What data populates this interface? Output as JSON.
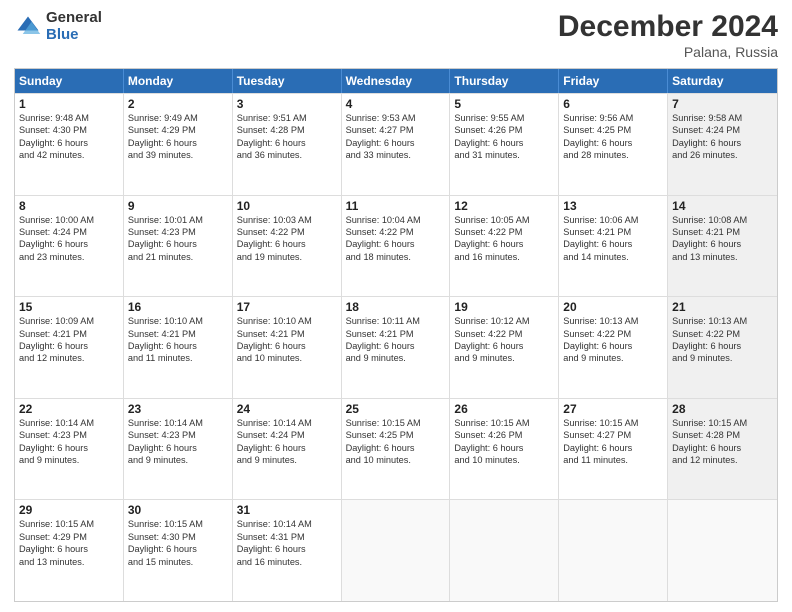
{
  "logo": {
    "general": "General",
    "blue": "Blue"
  },
  "title": {
    "month": "December 2024",
    "location": "Palana, Russia"
  },
  "header_days": [
    "Sunday",
    "Monday",
    "Tuesday",
    "Wednesday",
    "Thursday",
    "Friday",
    "Saturday"
  ],
  "weeks": [
    [
      {
        "day": "1",
        "info": "Sunrise: 9:48 AM\nSunset: 4:30 PM\nDaylight: 6 hours\nand 42 minutes.",
        "empty": false,
        "shaded": false
      },
      {
        "day": "2",
        "info": "Sunrise: 9:49 AM\nSunset: 4:29 PM\nDaylight: 6 hours\nand 39 minutes.",
        "empty": false,
        "shaded": false
      },
      {
        "day": "3",
        "info": "Sunrise: 9:51 AM\nSunset: 4:28 PM\nDaylight: 6 hours\nand 36 minutes.",
        "empty": false,
        "shaded": false
      },
      {
        "day": "4",
        "info": "Sunrise: 9:53 AM\nSunset: 4:27 PM\nDaylight: 6 hours\nand 33 minutes.",
        "empty": false,
        "shaded": false
      },
      {
        "day": "5",
        "info": "Sunrise: 9:55 AM\nSunset: 4:26 PM\nDaylight: 6 hours\nand 31 minutes.",
        "empty": false,
        "shaded": false
      },
      {
        "day": "6",
        "info": "Sunrise: 9:56 AM\nSunset: 4:25 PM\nDaylight: 6 hours\nand 28 minutes.",
        "empty": false,
        "shaded": false
      },
      {
        "day": "7",
        "info": "Sunrise: 9:58 AM\nSunset: 4:24 PM\nDaylight: 6 hours\nand 26 minutes.",
        "empty": false,
        "shaded": true
      }
    ],
    [
      {
        "day": "8",
        "info": "Sunrise: 10:00 AM\nSunset: 4:24 PM\nDaylight: 6 hours\nand 23 minutes.",
        "empty": false,
        "shaded": false
      },
      {
        "day": "9",
        "info": "Sunrise: 10:01 AM\nSunset: 4:23 PM\nDaylight: 6 hours\nand 21 minutes.",
        "empty": false,
        "shaded": false
      },
      {
        "day": "10",
        "info": "Sunrise: 10:03 AM\nSunset: 4:22 PM\nDaylight: 6 hours\nand 19 minutes.",
        "empty": false,
        "shaded": false
      },
      {
        "day": "11",
        "info": "Sunrise: 10:04 AM\nSunset: 4:22 PM\nDaylight: 6 hours\nand 18 minutes.",
        "empty": false,
        "shaded": false
      },
      {
        "day": "12",
        "info": "Sunrise: 10:05 AM\nSunset: 4:22 PM\nDaylight: 6 hours\nand 16 minutes.",
        "empty": false,
        "shaded": false
      },
      {
        "day": "13",
        "info": "Sunrise: 10:06 AM\nSunset: 4:21 PM\nDaylight: 6 hours\nand 14 minutes.",
        "empty": false,
        "shaded": false
      },
      {
        "day": "14",
        "info": "Sunrise: 10:08 AM\nSunset: 4:21 PM\nDaylight: 6 hours\nand 13 minutes.",
        "empty": false,
        "shaded": true
      }
    ],
    [
      {
        "day": "15",
        "info": "Sunrise: 10:09 AM\nSunset: 4:21 PM\nDaylight: 6 hours\nand 12 minutes.",
        "empty": false,
        "shaded": false
      },
      {
        "day": "16",
        "info": "Sunrise: 10:10 AM\nSunset: 4:21 PM\nDaylight: 6 hours\nand 11 minutes.",
        "empty": false,
        "shaded": false
      },
      {
        "day": "17",
        "info": "Sunrise: 10:10 AM\nSunset: 4:21 PM\nDaylight: 6 hours\nand 10 minutes.",
        "empty": false,
        "shaded": false
      },
      {
        "day": "18",
        "info": "Sunrise: 10:11 AM\nSunset: 4:21 PM\nDaylight: 6 hours\nand 9 minutes.",
        "empty": false,
        "shaded": false
      },
      {
        "day": "19",
        "info": "Sunrise: 10:12 AM\nSunset: 4:22 PM\nDaylight: 6 hours\nand 9 minutes.",
        "empty": false,
        "shaded": false
      },
      {
        "day": "20",
        "info": "Sunrise: 10:13 AM\nSunset: 4:22 PM\nDaylight: 6 hours\nand 9 minutes.",
        "empty": false,
        "shaded": false
      },
      {
        "day": "21",
        "info": "Sunrise: 10:13 AM\nSunset: 4:22 PM\nDaylight: 6 hours\nand 9 minutes.",
        "empty": false,
        "shaded": true
      }
    ],
    [
      {
        "day": "22",
        "info": "Sunrise: 10:14 AM\nSunset: 4:23 PM\nDaylight: 6 hours\nand 9 minutes.",
        "empty": false,
        "shaded": false
      },
      {
        "day": "23",
        "info": "Sunrise: 10:14 AM\nSunset: 4:23 PM\nDaylight: 6 hours\nand 9 minutes.",
        "empty": false,
        "shaded": false
      },
      {
        "day": "24",
        "info": "Sunrise: 10:14 AM\nSunset: 4:24 PM\nDaylight: 6 hours\nand 9 minutes.",
        "empty": false,
        "shaded": false
      },
      {
        "day": "25",
        "info": "Sunrise: 10:15 AM\nSunset: 4:25 PM\nDaylight: 6 hours\nand 10 minutes.",
        "empty": false,
        "shaded": false
      },
      {
        "day": "26",
        "info": "Sunrise: 10:15 AM\nSunset: 4:26 PM\nDaylight: 6 hours\nand 10 minutes.",
        "empty": false,
        "shaded": false
      },
      {
        "day": "27",
        "info": "Sunrise: 10:15 AM\nSunset: 4:27 PM\nDaylight: 6 hours\nand 11 minutes.",
        "empty": false,
        "shaded": false
      },
      {
        "day": "28",
        "info": "Sunrise: 10:15 AM\nSunset: 4:28 PM\nDaylight: 6 hours\nand 12 minutes.",
        "empty": false,
        "shaded": true
      }
    ],
    [
      {
        "day": "29",
        "info": "Sunrise: 10:15 AM\nSunset: 4:29 PM\nDaylight: 6 hours\nand 13 minutes.",
        "empty": false,
        "shaded": false
      },
      {
        "day": "30",
        "info": "Sunrise: 10:15 AM\nSunset: 4:30 PM\nDaylight: 6 hours\nand 15 minutes.",
        "empty": false,
        "shaded": false
      },
      {
        "day": "31",
        "info": "Sunrise: 10:14 AM\nSunset: 4:31 PM\nDaylight: 6 hours\nand 16 minutes.",
        "empty": false,
        "shaded": false
      },
      {
        "day": "",
        "info": "",
        "empty": true,
        "shaded": false
      },
      {
        "day": "",
        "info": "",
        "empty": true,
        "shaded": false
      },
      {
        "day": "",
        "info": "",
        "empty": true,
        "shaded": false
      },
      {
        "day": "",
        "info": "",
        "empty": true,
        "shaded": true
      }
    ]
  ]
}
